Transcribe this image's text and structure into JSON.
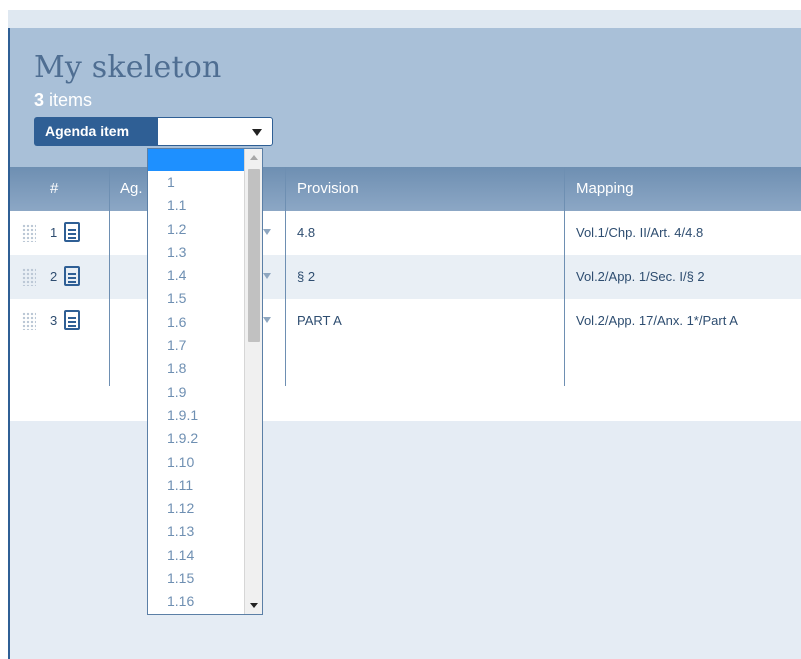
{
  "skeleton": {
    "title": "My skeleton",
    "count_number": "3",
    "count_label": "items"
  },
  "filter": {
    "label": "Agenda item",
    "selected_value": ""
  },
  "table": {
    "headers": {
      "number": "#",
      "agenda": "Ag.",
      "provision": "Provision",
      "mapping": "Mapping"
    },
    "rows": [
      {
        "number": "1",
        "provision": "4.8",
        "mapping": "Vol.1/Chp. II/Art. 4/4.8"
      },
      {
        "number": "2",
        "provision": "§ 2",
        "mapping": "Vol.2/App. 1/Sec. I/§ 2"
      },
      {
        "number": "3",
        "provision": "PART A",
        "mapping": "Vol.2/App. 17/Anx. 1*/Part A"
      }
    ]
  },
  "dropdown": {
    "options": [
      "",
      "1",
      "1.1",
      "1.2",
      "1.3",
      "1.4",
      "1.5",
      "1.6",
      "1.7",
      "1.8",
      "1.9",
      "1.9.1",
      "1.9.2",
      "1.10",
      "1.11",
      "1.12",
      "1.13",
      "1.14",
      "1.15",
      "1.16"
    ]
  },
  "icons": {
    "drag_handle": "drag-handle-icon",
    "document": "document-icon",
    "select_arrow": "caret-down-icon"
  },
  "colors": {
    "accent": "#2f5f95",
    "header_bg": "#a9c0d8",
    "selected_option": "#1e90ff"
  }
}
